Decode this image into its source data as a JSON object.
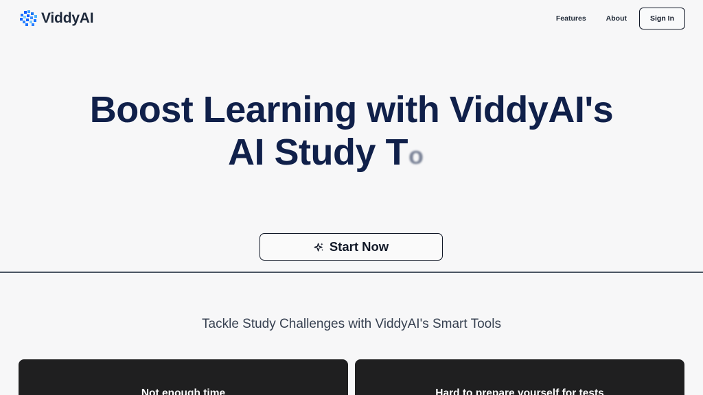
{
  "brand": {
    "name": "ViddyAI",
    "logo_icon": "pixel-cluster-logo-icon",
    "primary_color": "#1e7dff",
    "title_color": "#10204a"
  },
  "header": {
    "nav_items": [
      {
        "label": "Features"
      },
      {
        "label": "About"
      }
    ],
    "sign_in_label": "Sign In"
  },
  "hero": {
    "title_line_one": "Boost Learning with ViddyAI's",
    "title_line_two_prefix": "AI Study T",
    "title_line_two_animated": "o",
    "start_button_label": "Start Now",
    "start_button_icon": "sparkle-icon"
  },
  "challenges": {
    "heading": "Tackle Study Challenges with ViddyAI's Smart Tools",
    "cards": [
      {
        "title": "Not enough time"
      },
      {
        "title": "Hard to prepare yourself for tests"
      }
    ]
  }
}
